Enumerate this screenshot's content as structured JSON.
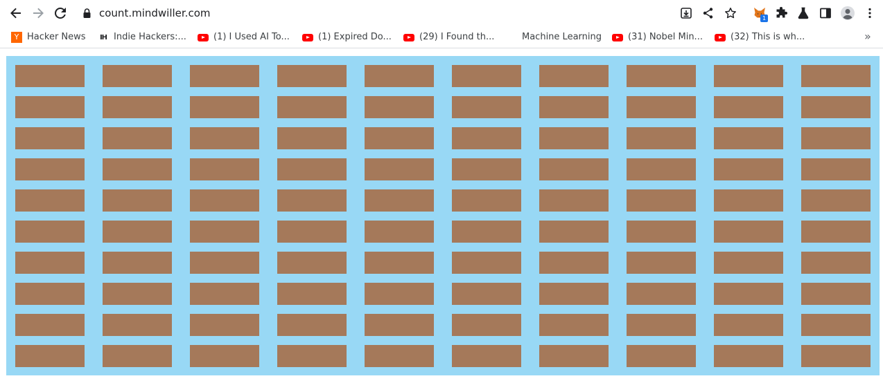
{
  "browser": {
    "url": "count.mindwiller.com",
    "extension_badge": "1",
    "icons": {
      "back": "arrow-left-icon",
      "forward": "arrow-right-icon",
      "reload": "reload-icon",
      "lock": "lock-icon",
      "install": "install-icon",
      "share": "share-icon",
      "bookmark": "star-icon",
      "extension": "metamask-fox-icon",
      "extensions": "puzzle-icon",
      "labs": "flask-icon",
      "side_panel": "side-panel-icon",
      "profile": "avatar-icon",
      "menu": "kebab-menu-icon"
    }
  },
  "bookmarks": [
    {
      "label": "Hacker News",
      "icon": "yc-icon"
    },
    {
      "label": "Indie Hackers:...",
      "icon": "ih-icon"
    },
    {
      "label": "(1) I Used AI To...",
      "icon": "youtube-icon"
    },
    {
      "label": "(1) Expired Do...",
      "icon": "youtube-icon"
    },
    {
      "label": "(29) I Found th...",
      "icon": "youtube-icon"
    },
    {
      "label": "Machine Learning",
      "icon": "blank-icon"
    },
    {
      "label": "(31) Nobel Min...",
      "icon": "youtube-icon"
    },
    {
      "label": "(32) This is wh...",
      "icon": "youtube-icon"
    }
  ],
  "bookmarks_overflow": "»",
  "canvas": {
    "background_color": "#98d8f5",
    "brick_color": "#a5795a",
    "rows": 10,
    "columns": 10
  }
}
